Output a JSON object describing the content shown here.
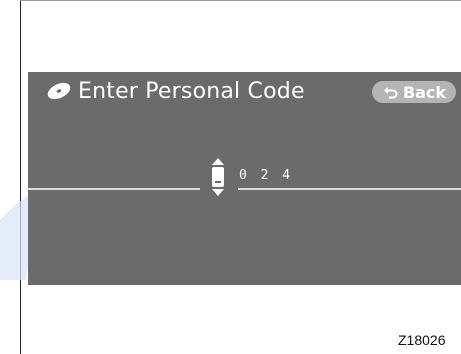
{
  "screen": {
    "title": "Enter Personal Code",
    "back_label": "Back",
    "code_value": "0 2 4"
  },
  "figure": {
    "ref_code": "Z18026"
  },
  "icons": {
    "title_icon": "disc-icon",
    "back_icon": "return-arrow-icon",
    "stepper_icon": "up-down-stepper-icon"
  },
  "colors": {
    "screen_bg": "#6b6b6b",
    "button_bg": "#b4b4b4",
    "text": "#ffffff",
    "line": "#d9d9d9"
  }
}
